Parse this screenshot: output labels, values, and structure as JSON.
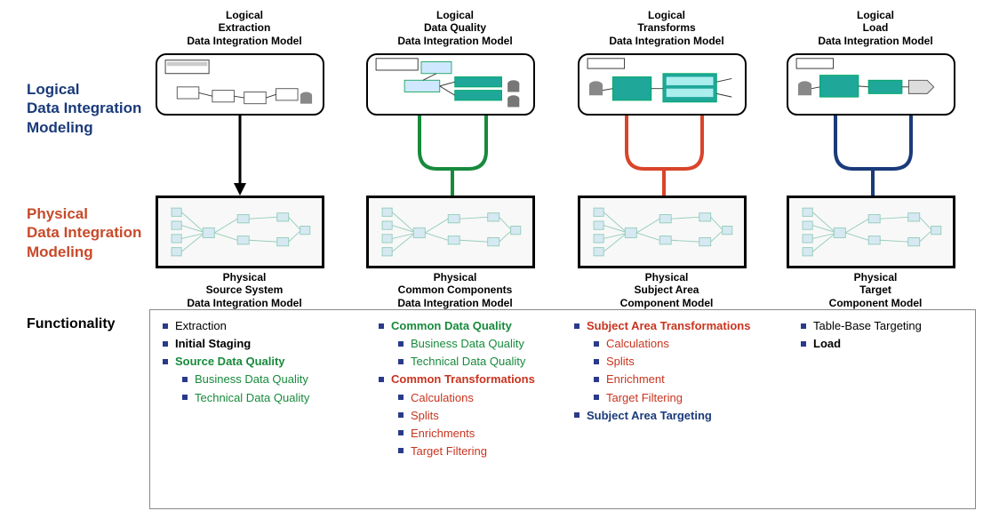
{
  "rows": {
    "logical": "Logical\nData Integration\nModeling",
    "physical": "Physical\nData Integration\nModeling",
    "functionality": "Functionality"
  },
  "columns": [
    {
      "top": "Logical\nExtraction\nData Integration Model",
      "bottom": "Physical\nSource System\nData Integration Model"
    },
    {
      "top": "Logical\nData Quality\nData Integration Model",
      "bottom": "Physical\nCommon Components\nData Integration Model"
    },
    {
      "top": "Logical\nTransforms\nData Integration Model",
      "bottom": "Physical\nSubject Area\nComponent Model"
    },
    {
      "top": "Logical\nLoad\nData Integration Model",
      "bottom": "Physical\nTarget\nComponent Model"
    }
  ],
  "functionality": {
    "col1": {
      "items": [
        {
          "label": "Extraction",
          "cls": "t-black"
        },
        {
          "label": "Initial Staging",
          "cls": "t-black bold"
        },
        {
          "label": "Source Data Quality",
          "cls": "t-green bold",
          "children": [
            {
              "label": "Business Data Quality",
              "cls": "t-green"
            },
            {
              "label": "Technical Data Quality",
              "cls": "t-green"
            }
          ]
        }
      ]
    },
    "col2": {
      "items": [
        {
          "label": "Common Data Quality",
          "cls": "t-green bold",
          "children": [
            {
              "label": "Business Data Quality",
              "cls": "t-green"
            },
            {
              "label": "Technical Data Quality",
              "cls": "t-green"
            }
          ]
        },
        {
          "label": "Common Transformations",
          "cls": "t-red bold",
          "children": [
            {
              "label": "Calculations",
              "cls": "t-red"
            },
            {
              "label": "Splits",
              "cls": "t-red"
            },
            {
              "label": "Enrichments",
              "cls": "t-red"
            },
            {
              "label": "Target Filtering",
              "cls": "t-red"
            }
          ]
        }
      ]
    },
    "col3": {
      "items": [
        {
          "label": "Subject Area Transformations",
          "cls": "t-red bold",
          "children": [
            {
              "label": "Calculations",
              "cls": "t-red"
            },
            {
              "label": "Splits",
              "cls": "t-red"
            },
            {
              "label": "Enrichment",
              "cls": "t-red"
            },
            {
              "label": "Target Filtering",
              "cls": "t-red"
            }
          ]
        },
        {
          "label": "Subject Area Targeting",
          "cls": "t-navy bold"
        }
      ]
    },
    "col4": {
      "items": [
        {
          "label": "Table-Base Targeting",
          "cls": "t-black"
        },
        {
          "label": "Load",
          "cls": "t-black bold"
        }
      ]
    }
  },
  "connectors": {
    "c1": "#000000",
    "c2": "#178a3c",
    "c3": "#d9442a",
    "c4": "#1a3a7a"
  }
}
